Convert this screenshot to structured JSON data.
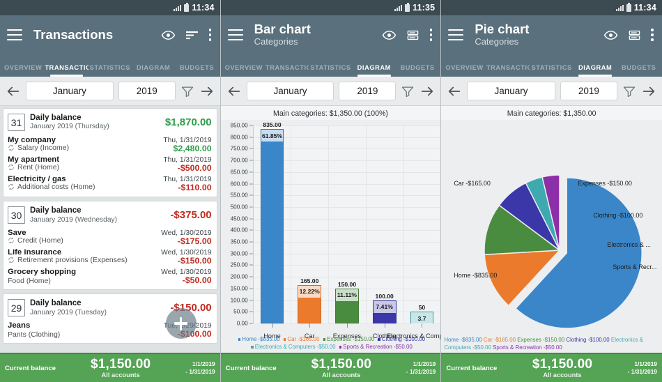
{
  "panels": [
    {
      "status": {
        "time": "11:34"
      },
      "appbar": {
        "title": "Transactions",
        "subtitle": ""
      },
      "tabs": [
        {
          "label": "OVERVIEW",
          "active": false
        },
        {
          "label": "TRANSACTIO",
          "active": true
        },
        {
          "label": "STATISTICS",
          "active": false
        },
        {
          "label": "DIAGRAM",
          "active": false
        },
        {
          "label": "BUDGETS",
          "active": false
        }
      ],
      "datenav": {
        "month": "January",
        "year": "2019"
      },
      "bottom": {
        "label": "Current balance",
        "amount": "$1,150.00",
        "sub": "All accounts",
        "range_from": "1/1/2019",
        "range_to": "- 1/31/2019"
      }
    },
    {
      "status": {
        "time": "11:35"
      },
      "appbar": {
        "title": "Bar chart",
        "subtitle": "Categories"
      },
      "tabs": [
        {
          "label": "OVERVIEW",
          "active": false
        },
        {
          "label": "TRANSACTIO",
          "active": false
        },
        {
          "label": "STATISTICS",
          "active": false
        },
        {
          "label": "DIAGRAM",
          "active": true
        },
        {
          "label": "BUDGETS",
          "active": false
        }
      ],
      "datenav": {
        "month": "January",
        "year": "2019"
      },
      "bottom": {
        "label": "Current balance",
        "amount": "$1,150.00",
        "sub": "All accounts",
        "range_from": "1/1/2019",
        "range_to": "- 1/31/2019"
      }
    },
    {
      "status": {
        "time": "11:34"
      },
      "appbar": {
        "title": "Pie chart",
        "subtitle": "Categories"
      },
      "tabs": [
        {
          "label": "OVERVIEW",
          "active": false
        },
        {
          "label": "TRANSACTIO",
          "active": false
        },
        {
          "label": "STATISTICS",
          "active": false
        },
        {
          "label": "DIAGRAM",
          "active": true
        },
        {
          "label": "BUDGETS",
          "active": false
        }
      ],
      "datenav": {
        "month": "January",
        "year": "2019"
      },
      "bottom": {
        "label": "Current balance",
        "amount": "$1,150.00",
        "sub": "All accounts",
        "range_from": "1/1/2019",
        "range_to": "- 1/31/2019"
      }
    }
  ],
  "transactions": {
    "groups": [
      {
        "day": "31",
        "title": "Daily balance",
        "subtitle": "January 2019 (Thursday)",
        "amount": "$1,870.00",
        "sign": "pos",
        "items": [
          {
            "name": "My company",
            "date": "Thu, 1/31/2019",
            "category": "Salary (Income)",
            "amount": "$2,480.00",
            "sign": "pos",
            "recurring": true
          },
          {
            "name": "My apartment",
            "date": "Thu, 1/31/2019",
            "category": "Rent (Home)",
            "amount": "-$500.00",
            "sign": "neg",
            "recurring": true
          },
          {
            "name": "Electricity / gas",
            "date": "Thu, 1/31/2019",
            "category": "Additional costs (Home)",
            "amount": "-$110.00",
            "sign": "neg",
            "recurring": true
          }
        ]
      },
      {
        "day": "30",
        "title": "Daily balance",
        "subtitle": "January 2019 (Wednesday)",
        "amount": "-$375.00",
        "sign": "neg",
        "items": [
          {
            "name": "Save",
            "date": "Wed, 1/30/2019",
            "category": "Credit (Home)",
            "amount": "-$175.00",
            "sign": "neg",
            "recurring": true
          },
          {
            "name": "Life insurance",
            "date": "Wed, 1/30/2019",
            "category": "Retirement provisions (Expenses)",
            "amount": "-$150.00",
            "sign": "neg",
            "recurring": true
          },
          {
            "name": "Grocery shopping",
            "date": "Wed, 1/30/2019",
            "category": "Food (Home)",
            "amount": "-$50.00",
            "sign": "neg",
            "recurring": false
          }
        ]
      },
      {
        "day": "29",
        "title": "Daily balance",
        "subtitle": "January 2019 (Tuesday)",
        "amount": "-$150.00",
        "sign": "neg",
        "items": [
          {
            "name": "Jeans",
            "date": "Tue, 1/29/2019",
            "category": "Pants (Clothing)",
            "amount": "-$100.00",
            "sign": "neg",
            "recurring": false
          }
        ]
      }
    ]
  },
  "chart_data": [
    {
      "type": "bar",
      "title": "Main categories: $1,350.00 (100%)",
      "xlabel": "",
      "ylabel": "",
      "ylim": [
        0,
        850
      ],
      "ytick_step": 50,
      "yticks": [
        "0.00",
        "50.00",
        "100.00",
        "150.00",
        "200.00",
        "250.00",
        "300.00",
        "350.00",
        "400.00",
        "450.00",
        "500.00",
        "550.00",
        "600.00",
        "650.00",
        "700.00",
        "750.00",
        "800.00",
        "850.00"
      ],
      "grid": true,
      "categories": [
        "Home",
        "Car",
        "Expenses",
        "Clothing",
        "Electronics & Computers"
      ],
      "values": [
        835,
        165,
        150,
        100,
        50
      ],
      "value_labels": [
        "835.00",
        "165.00",
        "150.00",
        "100.00",
        "50"
      ],
      "percent_labels": [
        "61.85%",
        "12.22%",
        "11.11%",
        "7.41%",
        "3.7"
      ],
      "colors": [
        "#3b86c8",
        "#ec7a2d",
        "#4a8c3f",
        "#3b37a8",
        "#3fa9b0"
      ],
      "legend_position": "bottom",
      "legend": [
        {
          "label": "Home -$835.00",
          "color": "#3b86c8"
        },
        {
          "label": "Car -$165.00",
          "color": "#ec7a2d"
        },
        {
          "label": "Expenses -$150.00",
          "color": "#4a8c3f"
        },
        {
          "label": "Clothing -$100.00",
          "color": "#3b37a8"
        },
        {
          "label": "Electronics & Computers -$50.00",
          "color": "#3fa9b0"
        },
        {
          "label": "Sports & Recreation -$50.00",
          "color": "#8d2fa8"
        }
      ]
    },
    {
      "type": "pie",
      "title": "Main categories: $1,350.00",
      "labels": [
        "Home",
        "Car",
        "Expenses",
        "Clothing",
        "Electronics & Computers",
        "Sports & Recreation"
      ],
      "values": [
        835,
        165,
        150,
        100,
        50,
        50
      ],
      "colors": [
        "#3b86c8",
        "#ec7a2d",
        "#4a8c3f",
        "#3b37a8",
        "#3fa9b0",
        "#8d2fa8"
      ],
      "callouts": [
        "Home -$835.00",
        "Car -$165.00",
        "Expenses -$150.00",
        "Clothing -$100.00",
        "Electronics & ...",
        "Sports & Recr..."
      ],
      "legend_position": "bottom",
      "legend": [
        {
          "label": "Home -$835.00",
          "color": "#3b86c8"
        },
        {
          "label": "Car -$165.00",
          "color": "#ec7a2d"
        },
        {
          "label": "Expenses -$150.00",
          "color": "#4a8c3f"
        },
        {
          "label": "Clothing -$100.00",
          "color": "#3b37a8"
        },
        {
          "label": "Electronics & Computers -$50.00",
          "color": "#3fa9b0"
        },
        {
          "label": "Sports & Recreation -$50.00",
          "color": "#8d2fa8"
        }
      ]
    }
  ],
  "icons": {
    "menu": "hamburger-icon",
    "eye": "eye-icon",
    "sort": "sort-icon",
    "table": "table-rows-icon",
    "more": "more-vertical-icon",
    "prev": "arrow-left-icon",
    "next": "arrow-right-icon",
    "filter": "funnel-icon",
    "add": "plus-icon"
  }
}
